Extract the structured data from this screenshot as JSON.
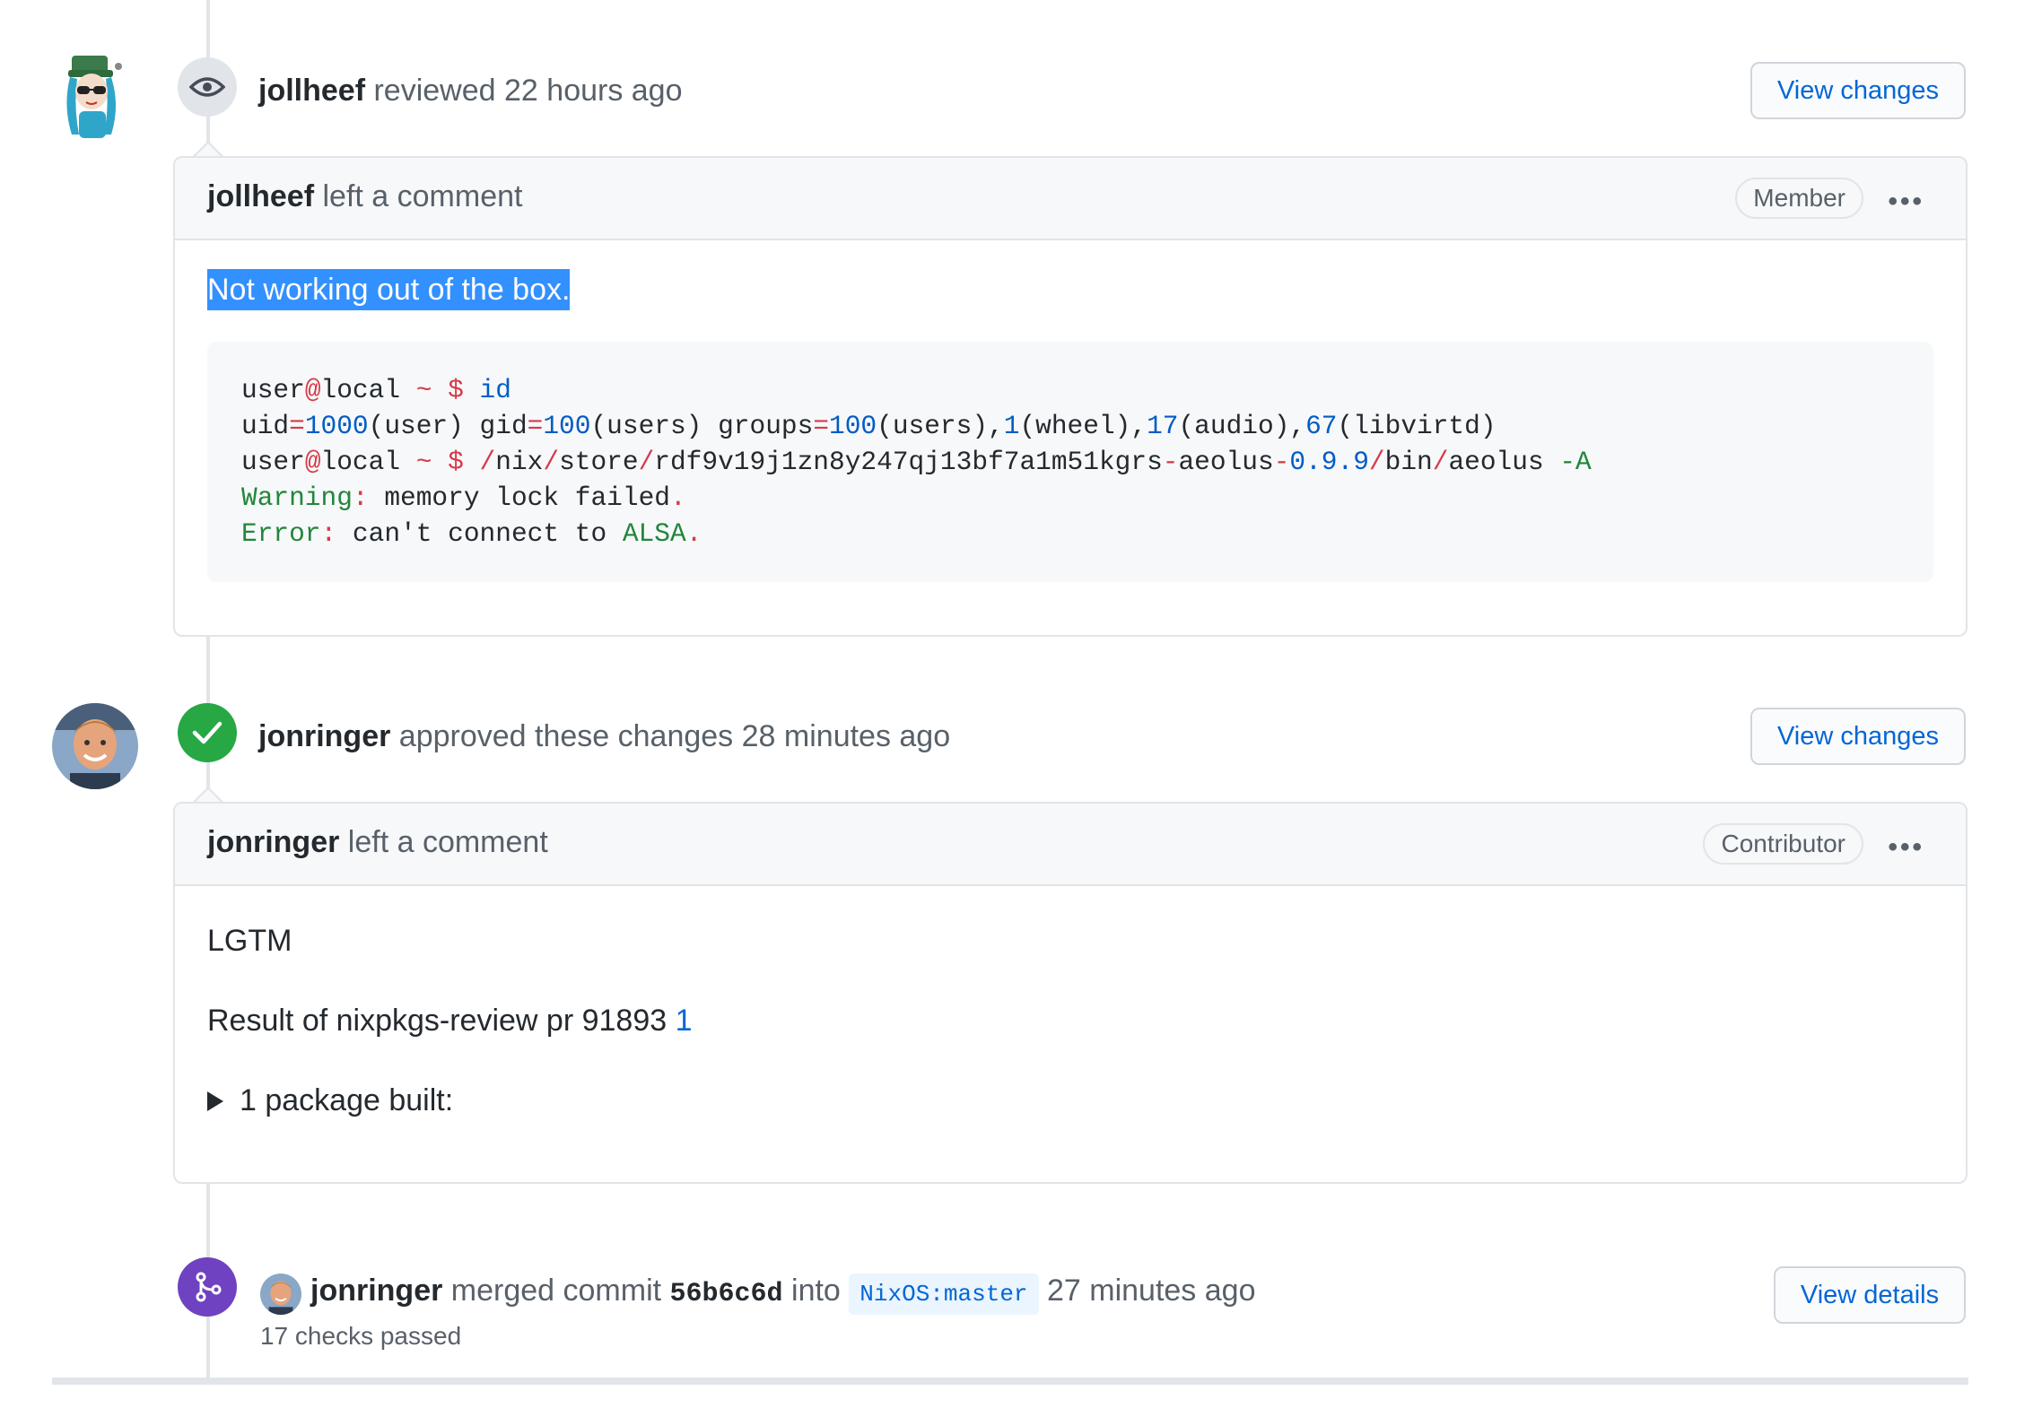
{
  "review1": {
    "author": "jollheef",
    "action": "reviewed",
    "time": "22 hours ago",
    "button": "View changes",
    "comment": {
      "author": "jollheef",
      "action": "left a comment",
      "role": "Member",
      "menu": "•••",
      "text": "Not working out of the box.",
      "code": [
        [
          {
            "t": "user",
            "c": ""
          },
          {
            "t": "@",
            "c": "red"
          },
          {
            "t": "local ",
            "c": ""
          },
          {
            "t": "~ $ ",
            "c": "red"
          },
          {
            "t": "id",
            "c": "blue"
          }
        ],
        [
          {
            "t": "uid",
            "c": ""
          },
          {
            "t": "=",
            "c": "red"
          },
          {
            "t": "1000",
            "c": "blue"
          },
          {
            "t": "(user) gid",
            "c": ""
          },
          {
            "t": "=",
            "c": "red"
          },
          {
            "t": "100",
            "c": "blue"
          },
          {
            "t": "(users) groups",
            "c": ""
          },
          {
            "t": "=",
            "c": "red"
          },
          {
            "t": "100",
            "c": "blue"
          },
          {
            "t": "(users),",
            "c": ""
          },
          {
            "t": "1",
            "c": "blue"
          },
          {
            "t": "(wheel),",
            "c": ""
          },
          {
            "t": "17",
            "c": "blue"
          },
          {
            "t": "(audio),",
            "c": ""
          },
          {
            "t": "67",
            "c": "blue"
          },
          {
            "t": "(libvirtd)",
            "c": ""
          }
        ],
        [
          {
            "t": "user",
            "c": ""
          },
          {
            "t": "@",
            "c": "red"
          },
          {
            "t": "local ",
            "c": ""
          },
          {
            "t": "~ $ /",
            "c": "red"
          },
          {
            "t": "nix",
            "c": ""
          },
          {
            "t": "/",
            "c": "red"
          },
          {
            "t": "store",
            "c": ""
          },
          {
            "t": "/",
            "c": "red"
          },
          {
            "t": "rdf9v19j1zn8y247qj13bf7a1m51kgrs",
            "c": ""
          },
          {
            "t": "-",
            "c": "red"
          },
          {
            "t": "aeolus",
            "c": ""
          },
          {
            "t": "-",
            "c": "red"
          },
          {
            "t": "0.9.9",
            "c": "blue"
          },
          {
            "t": "/",
            "c": "red"
          },
          {
            "t": "bin",
            "c": ""
          },
          {
            "t": "/",
            "c": "red"
          },
          {
            "t": "aeolus ",
            "c": ""
          },
          {
            "t": "-A",
            "c": "green"
          }
        ],
        [
          {
            "t": "Warning",
            "c": "green"
          },
          {
            "t": ":",
            "c": "red"
          },
          {
            "t": " memory lock failed",
            "c": ""
          },
          {
            "t": ".",
            "c": "red"
          }
        ],
        [
          {
            "t": "Error",
            "c": "green"
          },
          {
            "t": ":",
            "c": "red"
          },
          {
            "t": " can't connect to ",
            "c": ""
          },
          {
            "t": "ALSA",
            "c": "green"
          },
          {
            "t": ".",
            "c": "red"
          }
        ]
      ]
    }
  },
  "review2": {
    "author": "jonringer",
    "action": "approved these changes",
    "time": "28 minutes ago",
    "button": "View changes",
    "comment": {
      "author": "jonringer",
      "action": "left a comment",
      "role": "Contributor",
      "menu": "•••",
      "line1": "LGTM",
      "line2_prefix": "Result of nixpkgs-review pr 91893",
      "line2_link": "1",
      "details_summary": "1 package built:"
    }
  },
  "merge": {
    "author": "jonringer",
    "action": "merged commit",
    "sha": "56b6c6d",
    "into": "into",
    "branch": "NixOS:master",
    "time": "27 minutes ago",
    "checks": "17 checks passed",
    "button": "View details"
  },
  "colors": {
    "approved": "#28a745",
    "merged": "#6f42c1",
    "link": "#0366d6"
  },
  "icons": {
    "review": "eye-icon",
    "approved": "check-icon",
    "merged": "git-merge-icon"
  }
}
